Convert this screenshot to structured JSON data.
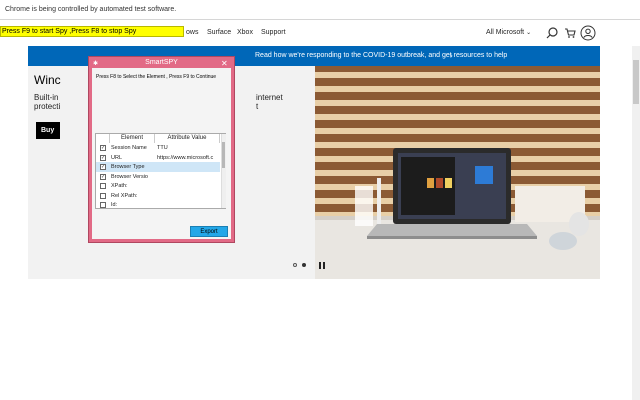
{
  "automation_bar": {
    "message": "Chrome is being controlled by automated test software."
  },
  "spy_banner": {
    "text": "Press F9 to start Spy ,Press F8 to stop Spy"
  },
  "header": {
    "nav": {
      "windows": "ows",
      "surface": "Surface",
      "xbox": "Xbox",
      "support": "Support"
    },
    "all_microsoft": "All Microsoft",
    "icons": [
      "search-icon",
      "cart-icon",
      "account-icon"
    ]
  },
  "covid_bar": {
    "text": "Read how we're responding to the COVID-19 outbreak, and get resources to help",
    "chevron": "›"
  },
  "hero": {
    "title": "Winc",
    "body_line1": "Built-in",
    "body_line2": "protecti",
    "body_line3": "internet",
    "body_line4": "t",
    "cta": "Buy"
  },
  "smartspy": {
    "title": "SmartSPY",
    "close": "✕",
    "instructions": "Press F8 to Select the Element , Press F9 to Continue",
    "columns": [
      "Element",
      "Attribute Value"
    ],
    "rows": [
      {
        "checked": true,
        "element": "Session Name",
        "value": "TTU"
      },
      {
        "checked": true,
        "element": "URL",
        "value": "https://www.microsoft.c"
      },
      {
        "checked": true,
        "element": "Browser Type",
        "value": ""
      },
      {
        "checked": true,
        "element": "Browser Versio",
        "value": ""
      },
      {
        "checked": false,
        "element": "XPath:",
        "value": ""
      },
      {
        "checked": false,
        "element": "Rel XPath:",
        "value": ""
      },
      {
        "checked": false,
        "element": "Id:",
        "value": ""
      }
    ],
    "selected_row_index": 2,
    "export_label": "Export"
  },
  "colors": {
    "banner": "#ffff00",
    "covid_blue": "#0067b8",
    "spy_pink": "#e26a86",
    "export_blue": "#23a7e8"
  }
}
